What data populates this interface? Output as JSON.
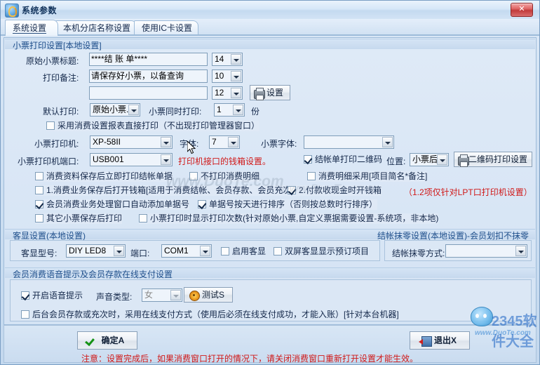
{
  "window": {
    "title": "系统参数",
    "icon": "app-icon",
    "close_label": "✕",
    "help_icon": "help-book-icon"
  },
  "tabs": [
    {
      "label": "系统设置",
      "active": true
    },
    {
      "label": "本机分店名称设置",
      "active": false
    },
    {
      "label": "使用IC卡设置",
      "active": false
    }
  ],
  "receipt_group": {
    "title": "小票打印设置[本地设置]",
    "rows": {
      "title_label": "原始小票标题:",
      "title_value": "****结 账 单****",
      "title_size": "14",
      "note_label": "打印备注:",
      "note_value": "请保存好小票，以备查询",
      "note_size": "10",
      "note2_value": "",
      "note2_size": "12",
      "settings_button": "设置",
      "default_print_label": "默认打印:",
      "default_print_value": "原始小票..",
      "simul_print_label": "小票同时打印:",
      "simul_print_value": "1",
      "copies_unit": "份",
      "direct_print_chk": "采用消费设置报表直接打印（不出现打印管理器窗口）",
      "printer_label": "小票打印机:",
      "printer_value": "XP-58II",
      "font_label": "字体:",
      "font_value": "7",
      "receipt_font_label": "小票字体:",
      "receipt_font_value": "",
      "port_label": "小票打印机端口:",
      "port_value": "USB001",
      "port_hint": "打印机接口的钱箱设置。",
      "qr_chk": "结帐单打印二维码",
      "qr_pos_label": "位置:",
      "qr_pos_value": "小票后",
      "qr_settings_button": "二维码打印设置"
    },
    "checks": {
      "c1": "消费资料保存后立即打印结帐单据",
      "c2": "不打印消费明细",
      "c3": "消费明细采用[项目简名*备注]",
      "c4": "1.消费业务保存后打开钱箱[适用于消费结帐、会员存款、会员充次]",
      "c5": "2.付款收现金时开钱箱",
      "c5_note": "（1.2项仅针对LPT口打印机设置）",
      "c6": "会员消费业务处理窗口自动添加单据号",
      "c7": "单据号按天进行排序（否则按总数时行排序）",
      "c8": "其它小票保存后打印",
      "c9": "小票打印时显示打印次数(针对原始小票,自定义票据需要设置-系统项，非本地)"
    }
  },
  "display_group": {
    "title": "客显设置(本地设置)",
    "model_label": "客显型号:",
    "model_value": "DIY LED8",
    "port_label": "端口:",
    "port_value": "COM1",
    "enable_chk": "启用客显",
    "dual_chk": "双屏客显显示预订项目"
  },
  "round_group": {
    "title": "结帐抹零设置(本地设置)-会员划扣不抹零",
    "mode_label": "结帐抹零方式:",
    "mode_value": ""
  },
  "voice_group": {
    "title": "会员消费语音提示及会员存款在线支付设置",
    "enable_chk": "开启语音提示",
    "type_label": "声音类型:",
    "type_value": "女",
    "test_button": "测试S",
    "online_pay_chk": "后台会员存款或充次时，采用在线支付方式（使用后必须在线支付成功，才能入账）[针对本台机器]"
  },
  "footer": {
    "ok_button": "确定A",
    "exit_button": "退出X",
    "notice": "注意：设置完成后，如果消费窗口打开的情况下，请关闭消费窗口重新打开设置才能生效。"
  },
  "checked": {
    "direct_print": false,
    "qr": true,
    "c1": false,
    "c2": false,
    "c3": false,
    "c4": false,
    "c5": true,
    "c6": true,
    "c7": true,
    "c8": false,
    "c9": false,
    "display_enable": false,
    "display_dual": false,
    "voice_enable": true,
    "online_pay": false
  },
  "watermarks": {
    "w1": "www.DuoTe.com",
    "w2": "2345软件大全",
    "w3": "www.DuoTe.com"
  },
  "colors": {
    "accent": "#20508c",
    "warning": "#d01818",
    "panel": "#dbe7f5",
    "window": "#c3d8ee"
  }
}
